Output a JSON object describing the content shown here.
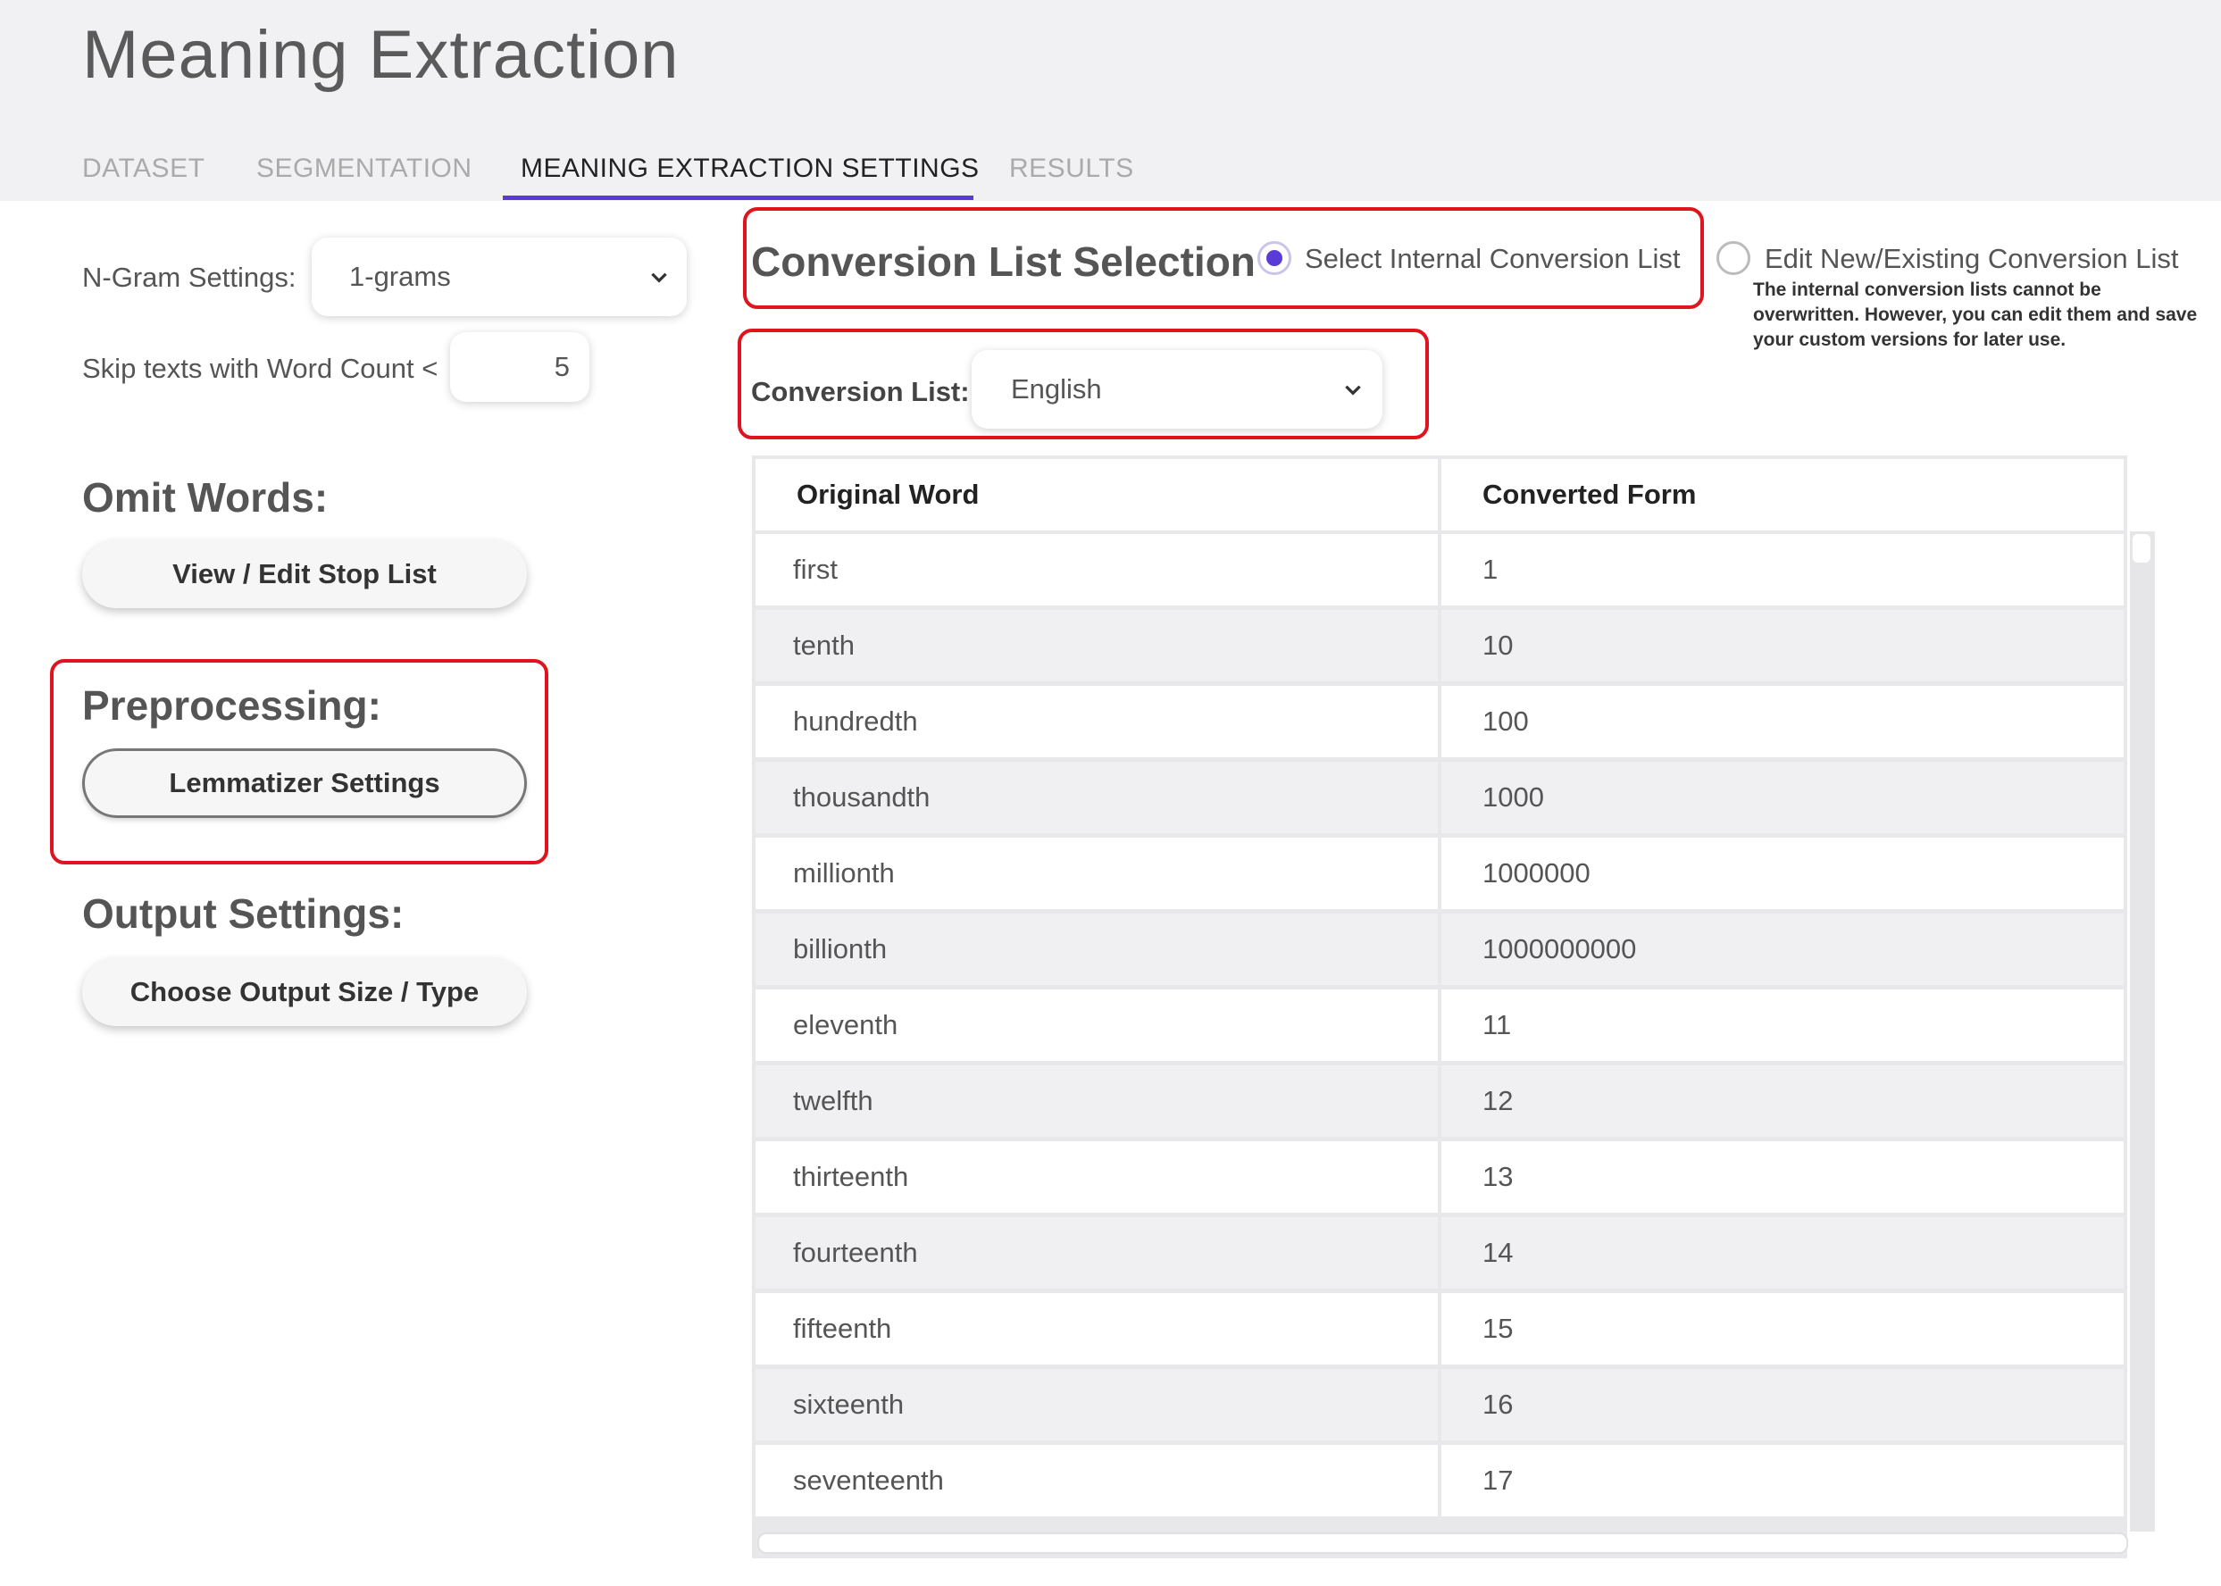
{
  "app": {
    "title": "Meaning Extraction"
  },
  "tabs": [
    {
      "label": "DATASET"
    },
    {
      "label": "SEGMENTATION"
    },
    {
      "label": "MEANING EXTRACTION SETTINGS",
      "active": true
    },
    {
      "label": "RESULTS"
    }
  ],
  "ngram": {
    "label": "N-Gram Settings:",
    "value": "1-grams"
  },
  "skip": {
    "label": "Skip texts with Word Count <",
    "value": "5"
  },
  "omit": {
    "title": "Omit Words:",
    "button": "View / Edit Stop List"
  },
  "preprocessing": {
    "title": "Preprocessing:",
    "button": "Lemmatizer Settings"
  },
  "output": {
    "title": "Output Settings:",
    "button": "Choose Output Size / Type"
  },
  "conversion": {
    "title": "Conversion List Selection",
    "option_internal": "Select Internal Conversion List",
    "option_edit": "Edit New/Existing Conversion List",
    "note": "The internal conversion lists cannot be overwritten. However, you can edit them and save your custom versions for later use.",
    "list_label": "Conversion List:",
    "list_value": "English",
    "selected_option": "internal"
  },
  "table": {
    "headers": [
      "Original Word",
      "Converted Form"
    ],
    "rows": [
      [
        "first",
        "1"
      ],
      [
        "tenth",
        "10"
      ],
      [
        "hundredth",
        "100"
      ],
      [
        "thousandth",
        "1000"
      ],
      [
        "millionth",
        "1000000"
      ],
      [
        "billionth",
        "1000000000"
      ],
      [
        "eleventh",
        "11"
      ],
      [
        "twelfth",
        "12"
      ],
      [
        "thirteenth",
        "13"
      ],
      [
        "fourteenth",
        "14"
      ],
      [
        "fifteenth",
        "15"
      ],
      [
        "sixteenth",
        "16"
      ],
      [
        "seventeenth",
        "17"
      ]
    ]
  },
  "colors": {
    "accent": "#5b3bd6",
    "highlight": "#e0141e"
  }
}
